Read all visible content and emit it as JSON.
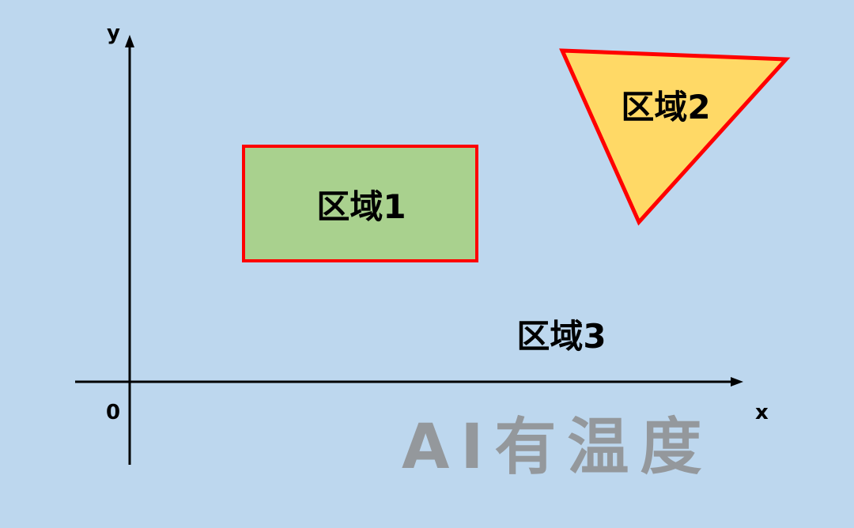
{
  "axes": {
    "x_label": "x",
    "y_label": "y",
    "origin_label": "0"
  },
  "regions": [
    {
      "label": "区域1",
      "shape": "rectangle",
      "fill": "#a9d18e",
      "stroke": "#ff0000"
    },
    {
      "label": "区域2",
      "shape": "triangle",
      "fill": "#ffd966",
      "stroke": "#ff0000"
    },
    {
      "label": "区域3",
      "shape": "none"
    }
  ],
  "watermark": "AI有温度",
  "colors": {
    "background": "#bdd7ee",
    "axis": "#000000",
    "watermark": "#8e8e8e"
  }
}
